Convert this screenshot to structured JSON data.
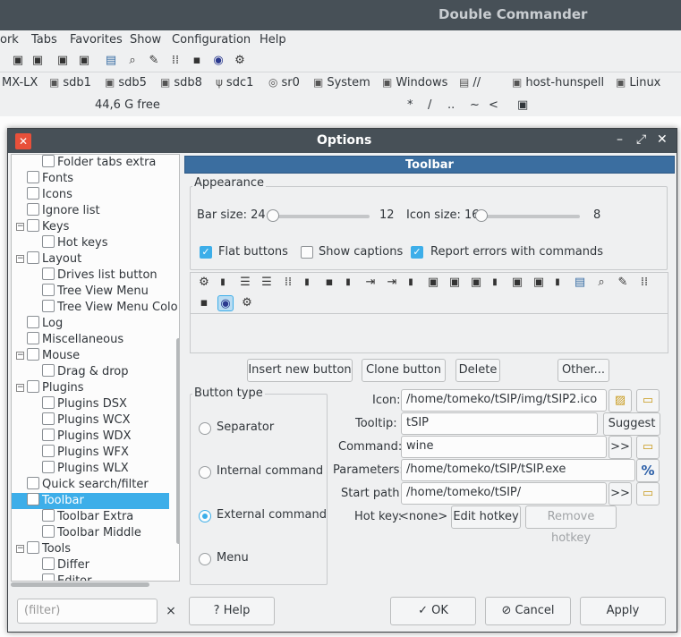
{
  "app_title": "Double Commander",
  "menu": [
    "ork",
    "Tabs",
    "Favorites",
    "Show",
    "Configuration",
    "Help"
  ],
  "drives": [
    {
      "label": "MX-LX",
      "icon": ""
    },
    {
      "label": "sdb1",
      "icon": "drive-icon"
    },
    {
      "label": "sdb5",
      "icon": "drive-icon"
    },
    {
      "label": "sdb8",
      "icon": "drive-icon"
    },
    {
      "label": "sdc1",
      "icon": "usb-icon"
    },
    {
      "label": "sr0",
      "icon": "cdrom-icon"
    },
    {
      "label": "System",
      "icon": "drive-icon"
    },
    {
      "label": "Windows",
      "icon": "drive-icon"
    },
    {
      "label": "//",
      "icon": "network-icon"
    },
    {
      "label": "host-hunspell",
      "icon": "drive-icon"
    },
    {
      "label": "Linux",
      "icon": "drive-icon"
    }
  ],
  "status": {
    "free": "44,6 G free",
    "nav": [
      "*",
      "/",
      "..",
      "~",
      "<"
    ]
  },
  "dialog": {
    "title": "Options",
    "tree": [
      {
        "label": "Folder tabs extra",
        "level": 1
      },
      {
        "label": "Fonts",
        "level": 0
      },
      {
        "label": "Icons",
        "level": 0
      },
      {
        "label": "Ignore list",
        "level": 0
      },
      {
        "label": "Keys",
        "level": 0,
        "exp": "−"
      },
      {
        "label": "Hot keys",
        "level": 1
      },
      {
        "label": "Layout",
        "level": 0,
        "exp": "−"
      },
      {
        "label": "Drives list button",
        "level": 1
      },
      {
        "label": "Tree View Menu",
        "level": 1
      },
      {
        "label": "Tree View Menu Colo",
        "level": 1
      },
      {
        "label": "Log",
        "level": 0
      },
      {
        "label": "Miscellaneous",
        "level": 0
      },
      {
        "label": "Mouse",
        "level": 0,
        "exp": "−"
      },
      {
        "label": "Drag & drop",
        "level": 1
      },
      {
        "label": "Plugins",
        "level": 0,
        "exp": "−"
      },
      {
        "label": "Plugins DSX",
        "level": 1
      },
      {
        "label": "Plugins WCX",
        "level": 1
      },
      {
        "label": "Plugins WDX",
        "level": 1
      },
      {
        "label": "Plugins WFX",
        "level": 1
      },
      {
        "label": "Plugins WLX",
        "level": 1
      },
      {
        "label": "Quick search/filter",
        "level": 0
      },
      {
        "label": "Toolbar",
        "level": 0,
        "exp": "−",
        "selected": true
      },
      {
        "label": "Toolbar Extra",
        "level": 1
      },
      {
        "label": "Toolbar Middle",
        "level": 1
      },
      {
        "label": "Tools",
        "level": 0,
        "exp": "−"
      },
      {
        "label": "Differ",
        "level": 1
      },
      {
        "label": "Editor",
        "level": 1
      }
    ],
    "filter_placeholder": "(filter)",
    "panel_title": "Toolbar",
    "appearance": {
      "group_label": "Appearance",
      "bar_size_label": "Bar size: 24",
      "bar_size_max": "12",
      "icon_size_label": "Icon size: 16",
      "icon_size_max": "8",
      "flat_buttons": {
        "label": "Flat buttons",
        "checked": true
      },
      "show_captions": {
        "label": "Show captions",
        "checked": false
      },
      "report_errors": {
        "label": "Report errors with commands",
        "checked": true
      }
    },
    "buttons": {
      "insert": "Insert new button",
      "clone": "Clone button",
      "delete": "Delete",
      "other": "Other..."
    },
    "button_type": {
      "group_label": "Button type",
      "options": [
        "Separator",
        "Internal command",
        "External command",
        "Menu"
      ],
      "selected": "External command"
    },
    "fields": {
      "icon_label": "Icon:",
      "icon_value": "/home/tomeko/tSIP/img/tSIP2.ico",
      "tooltip_label": "Tooltip:",
      "tooltip_value": "tSIP",
      "suggest": "Suggest",
      "command_label": "Command:",
      "command_value": "wine",
      "params_label": "Parameters:",
      "params_value": "/home/tomeko/tSIP/tSIP.exe",
      "start_label": "Start path:",
      "start_value": "/home/tomeko/tSIP/",
      "arrows": ">>",
      "percent": "%",
      "hotkey_label": "Hot key:",
      "hotkey_value": "<none>",
      "edit_hotkey": "Edit hotkey",
      "remove_hotkey": "Remove hotkey"
    },
    "footer": {
      "help": "Help",
      "ok": "OK",
      "cancel": "Cancel",
      "apply": "Apply"
    }
  }
}
